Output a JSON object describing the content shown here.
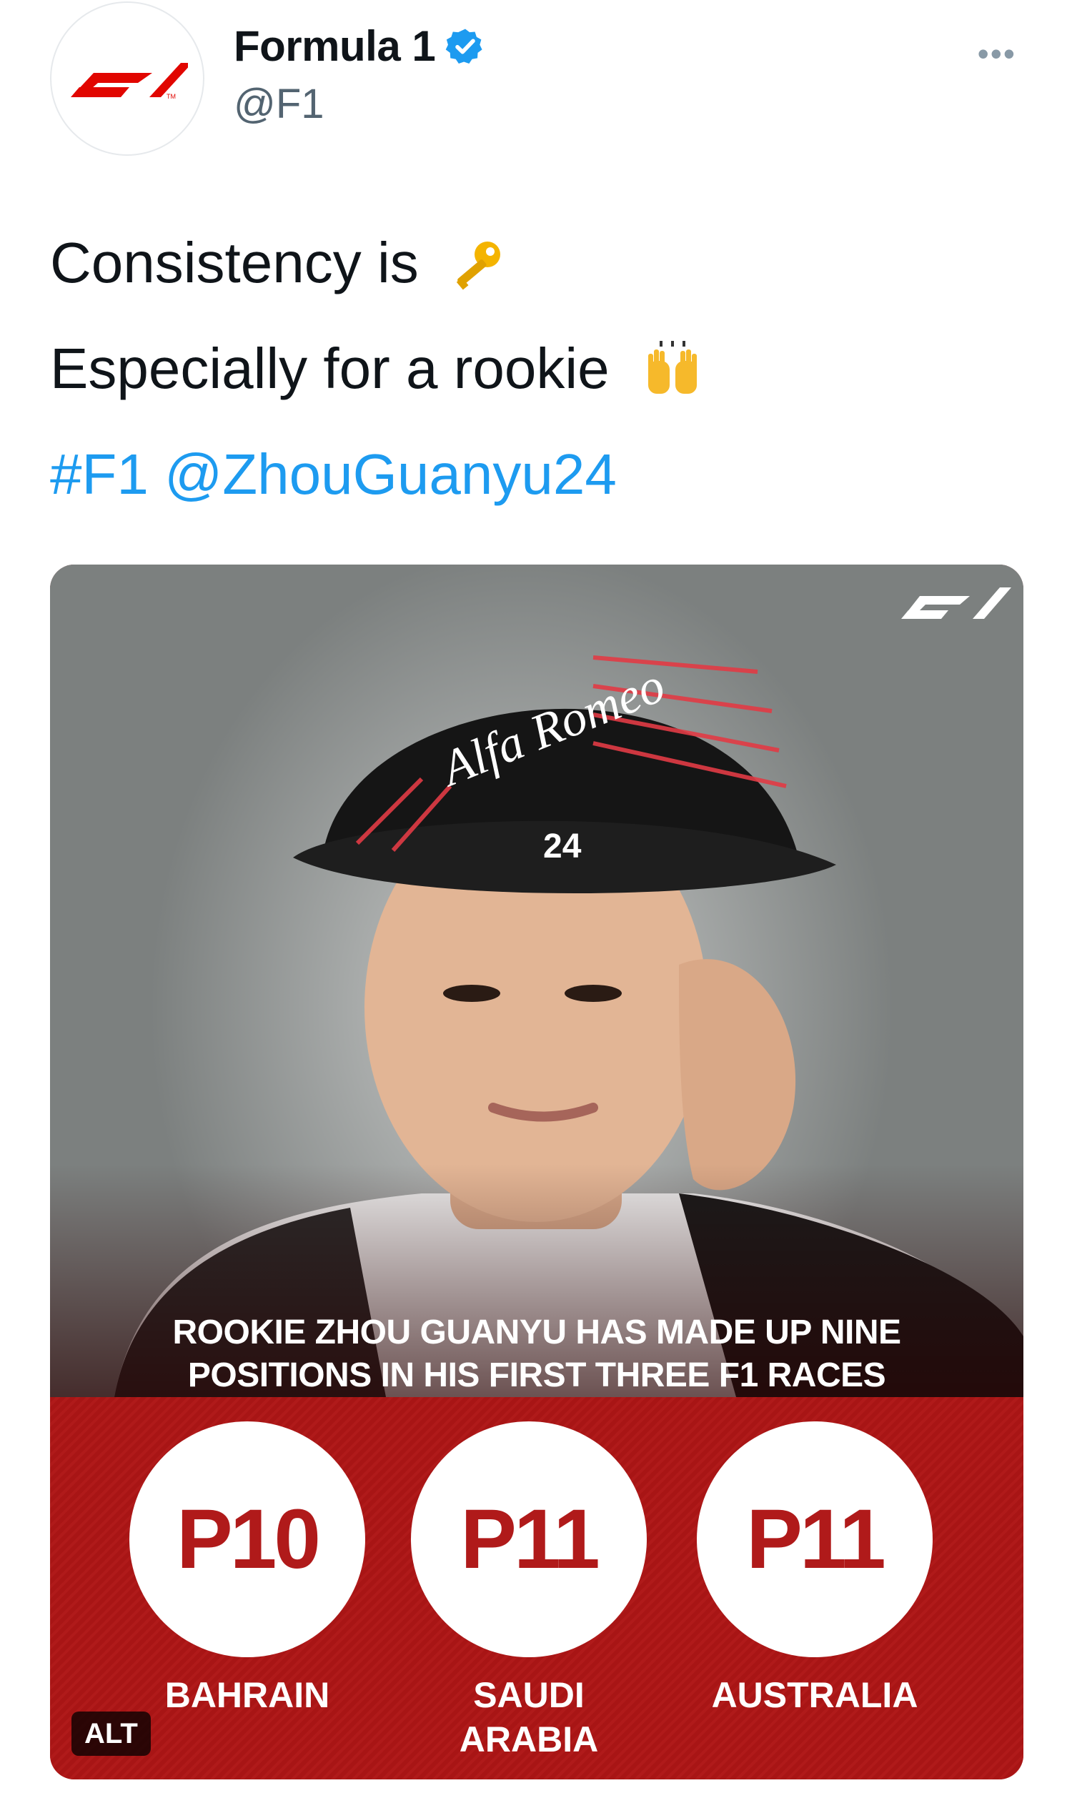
{
  "author": {
    "display_name": "Formula 1",
    "handle": "@F1",
    "avatar_icon": "f1-logo-icon",
    "verified_icon": "verified-badge-icon",
    "more_icon": "more-options-icon",
    "brand_color": "#e10600"
  },
  "tweet": {
    "line1": "Consistency is",
    "line1_emoji": "key-emoji",
    "line2": "Especially for a rookie",
    "line2_emoji": "raising-hands-emoji",
    "hashtag": "#F1",
    "mention": "@ZhouGuanyu24",
    "link_color": "#1d9bf0"
  },
  "media": {
    "headline_line1": "ROOKIE ZHOU GUANYU HAS MADE UP NINE",
    "headline_line2": "POSITIONS IN HIS FIRST THREE F1 RACES",
    "stats": [
      {
        "position": "P10",
        "race_line1": "BAHRAIN",
        "race_line2": ""
      },
      {
        "position": "P11",
        "race_line1": "SAUDI",
        "race_line2": "ARABIA"
      },
      {
        "position": "P11",
        "race_line1": "AUSTRALIA",
        "race_line2": ""
      }
    ],
    "alt_badge": "ALT",
    "cap_number": "24",
    "accent_color": "#b01a1a"
  }
}
